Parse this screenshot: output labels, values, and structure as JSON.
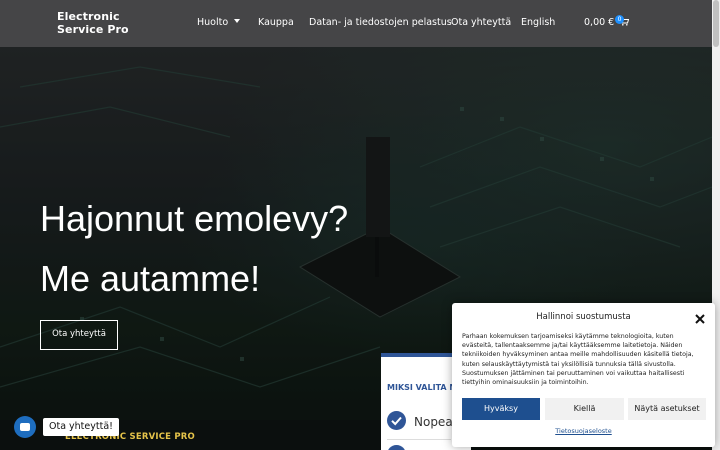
{
  "header": {
    "logo_line1": "Electronic",
    "logo_line2": "Service Pro",
    "nav": [
      "Huolto",
      "Kauppa",
      "Datan- ja tiedostojen pelastus",
      "Ota yhteyttä",
      "English"
    ],
    "cart_total": "0,00 €",
    "cart_count": "0"
  },
  "hero": {
    "title_line1": "Hajonnut emolevy?",
    "title_line2": "Me autamme!",
    "cta_label": "Ota yhteyttä"
  },
  "info_card": {
    "title": "MIKSI VALITA ME",
    "first_reason": "Nopea j"
  },
  "footer_strip": {
    "brand": "ELECTRONIC SERVICE PRO"
  },
  "chat": {
    "label": "Ota yhteyttä!"
  },
  "consent": {
    "title": "Hallinnoi suostumusta",
    "body": "Parhaan kokemuksen tarjoamiseksi käytämme teknologioita, kuten evästeitä, tallentaaksemme ja/tai käyttääksemme laitetietoja. Näiden tekniikoiden hyväksyminen antaa meille mahdollisuuden käsitellä tietoja, kuten selauskäyttäytymistä tai yksilöllisiä tunnuksia tällä sivustolla. Suostumuksen jättäminen tai peruuttaminen voi vaikuttaa haitallisesti tiettyihin ominaisuuksiin ja toimintoihin.",
    "accept_label": "Hyväksy",
    "deny_label": "Kiellä",
    "settings_label": "Näytä asetukset",
    "privacy_link": "Tietosuojaseloste"
  },
  "colors": {
    "header_bg": "#454547",
    "accent_blue": "#1e4f8f",
    "brand_gold": "#e6c44a",
    "chat_blue": "#1e6dbf"
  },
  "icons": [
    "caret-down-icon",
    "cart-icon",
    "close-icon",
    "check-circle-icon",
    "chat-icon"
  ]
}
